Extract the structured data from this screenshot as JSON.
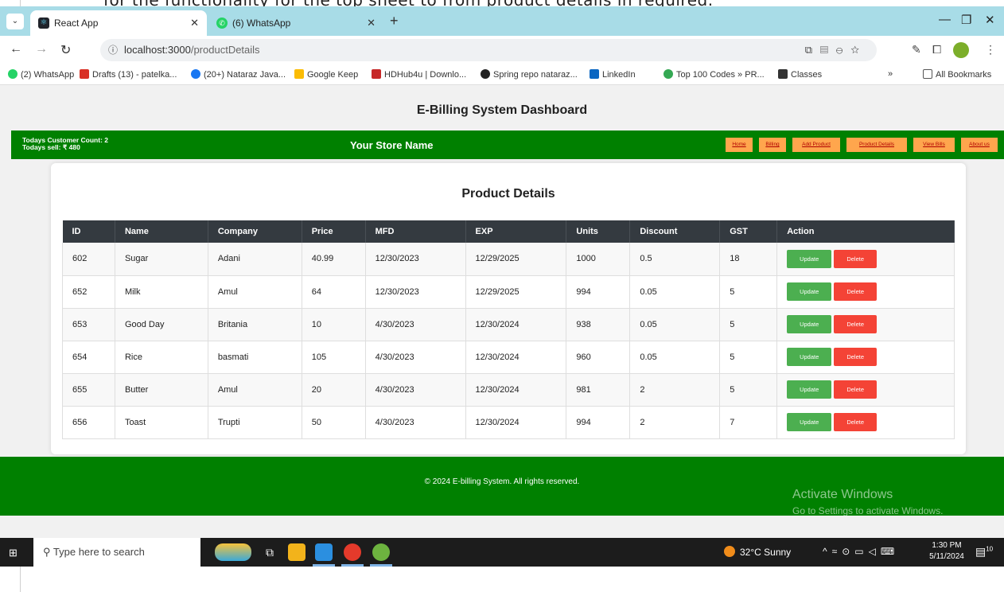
{
  "caption": "for the functionality for the top sheet to from product details in required.",
  "browser": {
    "tabs": [
      {
        "label": "React App",
        "active": true
      },
      {
        "label": "(6) WhatsApp",
        "active": false
      }
    ],
    "new_tab": "+",
    "url_host": "localhost:3000",
    "url_path": "/productDetails",
    "bookmarks": [
      "(2) WhatsApp",
      "Drafts (13) - patelka...",
      "(20+) Nataraz Java...",
      "Google Keep",
      "HDHub4u | Downlo...",
      "Spring repo nataraz...",
      "LinkedIn",
      "Top 100 Codes » PR...",
      "Classes",
      "All Bookmarks"
    ],
    "bookmarks_overflow": "»"
  },
  "app": {
    "dashboard_title": "E-Billing System Dashboard",
    "customer_count": "Todays Customer Count: 2",
    "todays_sell": "Todays sell: ₹ 480",
    "store_name": "Your Store Name",
    "nav": [
      "Home",
      "Billing",
      "Add Product",
      "Product Details",
      "View Bills",
      "About us"
    ],
    "card_title": "Product Details",
    "table": {
      "headers": [
        "ID",
        "Name",
        "Company",
        "Price",
        "MFD",
        "EXP",
        "Units",
        "Discount",
        "GST",
        "Action"
      ],
      "rows": [
        [
          "602",
          "Sugar",
          "Adani",
          "40.99",
          "12/30/2023",
          "12/29/2025",
          "1000",
          "0.5",
          "18"
        ],
        [
          "652",
          "Milk",
          "Amul",
          "64",
          "12/30/2023",
          "12/29/2025",
          "994",
          "0.05",
          "5"
        ],
        [
          "653",
          "Good Day",
          "Britania",
          "10",
          "4/30/2023",
          "12/30/2024",
          "938",
          "0.05",
          "5"
        ],
        [
          "654",
          "Rice",
          "basmati",
          "105",
          "4/30/2023",
          "12/30/2024",
          "960",
          "0.05",
          "5"
        ],
        [
          "655",
          "Butter",
          "Amul",
          "20",
          "4/30/2023",
          "12/30/2024",
          "981",
          "2",
          "5"
        ],
        [
          "656",
          "Toast",
          "Trupti",
          "50",
          "4/30/2023",
          "12/30/2024",
          "994",
          "2",
          "7"
        ]
      ],
      "update_label": "Update",
      "delete_label": "Delete"
    },
    "footer": "© 2024 E-billing System. All rights reserved."
  },
  "watermark": {
    "title": "Activate Windows",
    "subtitle": "Go to Settings to activate Windows."
  },
  "taskbar": {
    "search_placeholder": "Type here to search",
    "weather": "32°C  Sunny",
    "time": "1:30 PM",
    "date": "5/11/2024",
    "notifications": "10"
  },
  "colors": {
    "nav_green": "#008000",
    "nav_link_bg": "#ffa64d",
    "table_header": "#343a40",
    "update": "#4caf50",
    "delete": "#f44336"
  }
}
